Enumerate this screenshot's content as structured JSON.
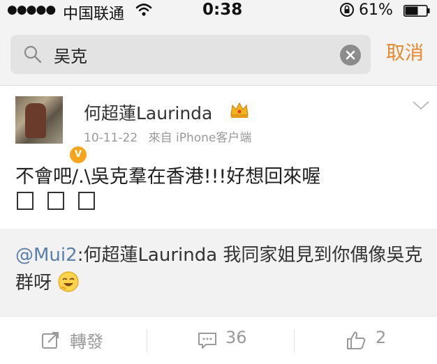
{
  "status_bar": {
    "signal": "●●●●●",
    "carrier": "中国联通",
    "time": "0:38",
    "battery_percent": "61%",
    "battery_level": 0.61
  },
  "search": {
    "value": "吴克",
    "cancel_label": "取消"
  },
  "post": {
    "author": "何超蓮Laurinda",
    "time": "10-11-22",
    "source": "來自 iPhone客户端",
    "text": "不會吧/.\\吳克羣在香港!!!好想回來喔",
    "repost": {
      "mention": "@Mui2",
      "text": ":何超蓮Laurinda 我同家姐見到你偶像吳克群呀"
    }
  },
  "actions": {
    "repost_label": "轉發",
    "comments_count": "36",
    "likes_count": "2"
  },
  "colors": {
    "accent": "#e7882d",
    "mention": "#5a7fa8",
    "verified_badge": "#f4a51c"
  },
  "icons": [
    "wifi-icon",
    "lock-rotation-icon",
    "battery-icon",
    "search-icon",
    "clear-icon",
    "crown-icon",
    "verified-badge-icon",
    "chevron-down-icon",
    "laughing-emoji-icon",
    "repost-icon",
    "comment-icon",
    "like-icon"
  ]
}
